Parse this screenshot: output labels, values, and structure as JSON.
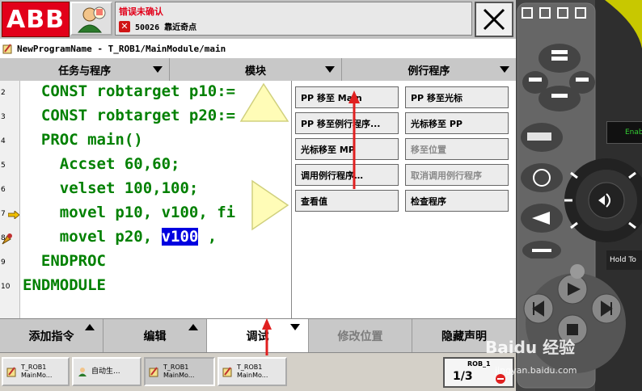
{
  "header": {
    "logo_text": "ABB",
    "status_title": "错误未确认",
    "status_code_msg": "50026 靠近奇点"
  },
  "path_bar": {
    "text": "NewProgramName - T_ROB1/MainModule/main"
  },
  "column_headers": [
    "任务与程序",
    "模块",
    "例行程序"
  ],
  "code": {
    "line_numbers": [
      "2",
      "3",
      "4",
      "5",
      "6",
      "7",
      "8",
      "9",
      "10"
    ],
    "lines": [
      "  CONST robtarget p10:=",
      "  CONST robtarget p20:=",
      "  PROC main()",
      "    Accset 60,60;",
      "    velset 100,100;",
      "    movel p10, v100, fi",
      "    movel p20, ",
      "  ENDPROC",
      "ENDMODULE"
    ],
    "highlighted_token": "v100",
    "after_highlight": " ,"
  },
  "menu": {
    "items": [
      {
        "label": "PP 移至 Main",
        "enabled": true
      },
      {
        "label": "PP 移至光标",
        "enabled": true
      },
      {
        "label": "PP 移至例行程序...",
        "enabled": true
      },
      {
        "label": "光标移至 PP",
        "enabled": true
      },
      {
        "label": "光标移至 MP",
        "enabled": true
      },
      {
        "label": "移至位置",
        "enabled": false
      },
      {
        "label": "调用例行程序…",
        "enabled": true
      },
      {
        "label": "取消调用例行程序",
        "enabled": false
      },
      {
        "label": "查看值",
        "enabled": true
      },
      {
        "label": "检查程序",
        "enabled": true
      }
    ]
  },
  "bottom_tabs": [
    {
      "label": "添加指令",
      "state": "normal"
    },
    {
      "label": "编辑",
      "state": "normal"
    },
    {
      "label": "调试",
      "state": "active"
    },
    {
      "label": "修改位置",
      "state": "disabled"
    },
    {
      "label": "隐藏声明",
      "state": "normal"
    }
  ],
  "taskbar": {
    "items": [
      {
        "line1": "T_ROB1",
        "line2": "MainMo..."
      },
      {
        "line1": "自动生...",
        "line2": ""
      },
      {
        "line1": "T_ROB1",
        "line2": "MainMo..."
      },
      {
        "line1": "T_ROB1",
        "line2": "MainMo..."
      }
    ],
    "rob_label": "ROB_1",
    "rob_fraction": "1/3"
  },
  "pendant": {
    "enable_label": "Enab",
    "hold_label": "Hold To"
  },
  "watermark": {
    "brand": "Baidu 经验",
    "url": "jingyan.baidu.com"
  },
  "colors": {
    "abb_red": "#e2001a",
    "code_green": "#008000",
    "highlight_blue": "#0000e0",
    "annotation_red": "#e02020",
    "pointer_yellow": "#fffcb0"
  }
}
